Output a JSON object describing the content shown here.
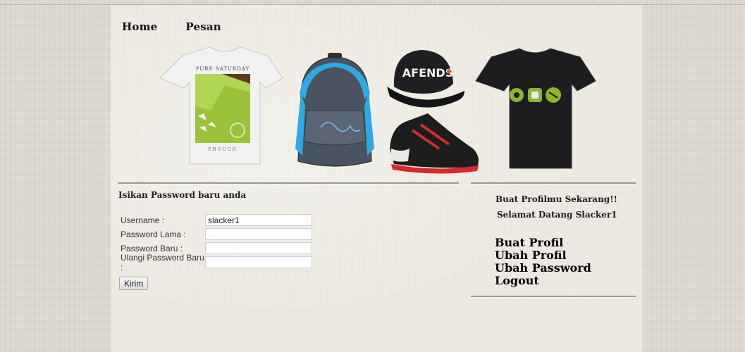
{
  "nav": {
    "home": "Home",
    "pesan": "Pesan"
  },
  "banner": {
    "tshirt_white_top": "PURE SATURDAY",
    "tshirt_white_bottom": "ENOUGH",
    "cap_text": "AFENDS"
  },
  "form": {
    "title": "Isikan Password baru anda",
    "fields": [
      {
        "label": "Username :",
        "value": "slacker1"
      },
      {
        "label": "Password Lama :",
        "value": ""
      },
      {
        "label": "Password Baru :",
        "value": ""
      },
      {
        "label": "Ulangi Password Baru :",
        "value": ""
      }
    ],
    "submit": "Kirim"
  },
  "sidebar": {
    "promo": "Buat Profilmu Sekarang!!",
    "welcome": "Selamat Datang Slacker1",
    "links": [
      "Buat Profil",
      "Ubah Profil",
      "Ubah Password",
      "Logout"
    ]
  },
  "colors": {
    "cap_accent": "#e8541c",
    "shirt_print_green": "#8ab82a",
    "backpack_blue": "#2ea9e6",
    "sneaker_red": "#d62b2b"
  }
}
